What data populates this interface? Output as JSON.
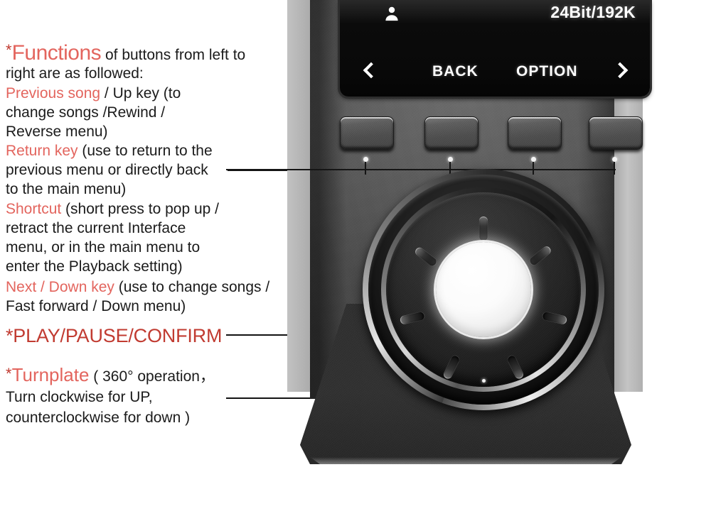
{
  "annotations": {
    "functions": {
      "star": "*",
      "keyword": "Functions",
      "rest_line1": " of buttons from left to",
      "line2": "right are as followed:"
    },
    "previous_song": {
      "keyword": "Previous song",
      "rest_line1": " / Up key (to",
      "line2": "change songs /Rewind /",
      "line3": "Reverse menu)"
    },
    "return_key": {
      "keyword": "Return key",
      "rest_line1": " (use to return to the",
      "line2": "previous menu or directly back",
      "line3": " to the main menu)"
    },
    "shortcut": {
      "keyword": "Shortcut",
      "rest_line1": " (short press to pop up /",
      "line2": " retract the current Interface",
      "line3": "menu, or in the main menu to",
      "line4": "enter the Playback setting)"
    },
    "next_down": {
      "keyword": "Next / Down key",
      "rest_line1": " (use to change songs /",
      "line2": "Fast forward / Down menu)"
    },
    "play_pause_confirm": {
      "text": "*PLAY/PAUSE/CONFIRM"
    },
    "turnplate": {
      "star": "*",
      "keyword": "Turnplate",
      "rest_line1": " ( 360° operation，",
      "line2": "Turn  clockwise for UP,",
      "line3": "counterclockwise for down )"
    }
  },
  "device": {
    "screen": {
      "user_icon": "person-icon",
      "audio_format": "24Bit/192K",
      "nav": {
        "prev_icon": "chevron-left-icon",
        "back_label": "BACK",
        "option_label": "OPTION",
        "next_icon": "chevron-right-icon"
      }
    },
    "buttons": [
      {
        "name": "previous-song-up-key"
      },
      {
        "name": "return-key"
      },
      {
        "name": "shortcut-key"
      },
      {
        "name": "next-down-key"
      }
    ],
    "jog_wheel": {
      "center_label": "",
      "center_function": "PLAY/PAUSE/CONFIRM",
      "slot_count": 7
    }
  },
  "colors": {
    "accent_red_light": "#e3655e",
    "accent_red_deep": "#c13b31",
    "body_text": "#1b1b1b",
    "leader_line": "#121212",
    "device_face": "#5b5b5b",
    "device_base": "#2f2f2f",
    "screen_bg": "#060606",
    "screen_text": "#ffffff",
    "led": "#f3f3f3",
    "background": "#ffffff"
  }
}
